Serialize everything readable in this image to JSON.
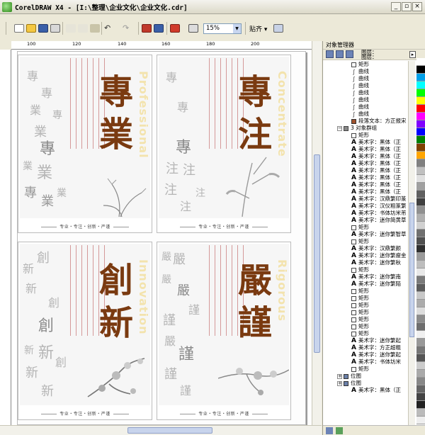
{
  "window": {
    "title": "CorelDRAW X4 - [I:\\整理\\企业文化\\企业文化.cdr]",
    "minimize": "_",
    "restore": "▫",
    "close": "×"
  },
  "toolbar": {
    "zoom_value": "15%",
    "snap_label": "贴齐 ▾",
    "icons": [
      "new-icon",
      "open-icon",
      "save-icon",
      "print-icon",
      "cut-icon",
      "copy-icon",
      "paste-icon",
      "undo-icon",
      "redo-icon",
      "import-icon",
      "export-icon",
      "app-launcher-icon",
      "welcome-icon",
      "zoom-dropdown",
      "snap-icon",
      "options-icon"
    ]
  },
  "ruler": {
    "ticks": [
      "100",
      "120",
      "140",
      "160",
      "180",
      "200"
    ]
  },
  "cards": [
    {
      "big_chars": [
        "專",
        "業"
      ],
      "english": "Professional",
      "footer": "专业・专注・创新・严谨",
      "gray_chars": [
        "專",
        "專",
        "業",
        "專",
        "業",
        "專",
        "業",
        "業",
        "專",
        "業",
        "業"
      ]
    },
    {
      "big_chars": [
        "專",
        "注"
      ],
      "english": "Concentrate",
      "footer": "专业・专注・创新・严谨",
      "gray_chars": [
        "專",
        "專",
        "專",
        "注",
        "注",
        "注",
        "注",
        "注"
      ]
    },
    {
      "big_chars": [
        "創",
        "新"
      ],
      "english": "Innovation",
      "footer": "专业・专注・创新・严谨",
      "gray_chars": [
        "新",
        "創",
        "新",
        "創",
        "創",
        "新",
        "新",
        "創",
        "新",
        "新"
      ]
    },
    {
      "big_chars": [
        "嚴",
        "謹"
      ],
      "english": "Rigorous",
      "footer": "专业・专注・创新・严谨",
      "gray_chars": [
        "嚴",
        "嚴",
        "嚴",
        "嚴",
        "謹",
        "謹",
        "嚴",
        "謹",
        "謹",
        "謹"
      ]
    }
  ],
  "docker": {
    "title": "对象管理器",
    "layer_line1": "图层：",
    "layer_line2": "图层：",
    "tree": [
      {
        "type": "rect",
        "label": "矩形"
      },
      {
        "type": "curve",
        "label": "曲线"
      },
      {
        "type": "curve",
        "label": "曲线"
      },
      {
        "type": "curve",
        "label": "曲线"
      },
      {
        "type": "curve",
        "label": "曲线"
      },
      {
        "type": "curve",
        "label": "曲线"
      },
      {
        "type": "curve",
        "label": "曲线"
      },
      {
        "type": "curve",
        "label": "曲线"
      },
      {
        "type": "ptext",
        "label": "段落文本：方正报宋"
      },
      {
        "type": "group",
        "label": "3 对象群组",
        "expander": "−"
      },
      {
        "type": "rect",
        "label": "矩形"
      },
      {
        "type": "text",
        "label": "美术字：黑体（正"
      },
      {
        "type": "text",
        "label": "美术字：黑体（正"
      },
      {
        "type": "text",
        "label": "美术字：黑体（正"
      },
      {
        "type": "text",
        "label": "美术字：黑体（正"
      },
      {
        "type": "text",
        "label": "美术字：黑体（正"
      },
      {
        "type": "text",
        "label": "美术字：黑体（正"
      },
      {
        "type": "text",
        "label": "美术字：黑体（正"
      },
      {
        "type": "text",
        "label": "美术字：黑体（正"
      },
      {
        "type": "text",
        "label": "美术字：汉鼎繁印篆"
      },
      {
        "type": "text",
        "label": "美术字：汉仪粗篆繁"
      },
      {
        "type": "text",
        "label": "美术字：书体坊米芾"
      },
      {
        "type": "text",
        "label": "美术字：迷你简黄草"
      },
      {
        "type": "rect",
        "label": "矩形"
      },
      {
        "type": "text",
        "label": "美术字：迷你繁智草"
      },
      {
        "type": "rect",
        "label": "矩形"
      },
      {
        "type": "text",
        "label": "美术字：汉鼎繁颜"
      },
      {
        "type": "text",
        "label": "美术字：迷你繁瘦金"
      },
      {
        "type": "text",
        "label": "美术字：迷你繁秋"
      },
      {
        "type": "rect",
        "label": "矩形"
      },
      {
        "type": "text",
        "label": "美术字：迷你繁南"
      },
      {
        "type": "text",
        "label": "美术字：迷你繁陌"
      },
      {
        "type": "rect",
        "label": "矩形"
      },
      {
        "type": "rect",
        "label": "矩形"
      },
      {
        "type": "rect",
        "label": "矩形"
      },
      {
        "type": "rect",
        "label": "矩形"
      },
      {
        "type": "rect",
        "label": "矩形"
      },
      {
        "type": "rect",
        "label": "矩形"
      },
      {
        "type": "rect",
        "label": "矩形"
      },
      {
        "type": "text",
        "label": "美术字：迷你繁起"
      },
      {
        "type": "text",
        "label": "美术字：方正超粗"
      },
      {
        "type": "text",
        "label": "美术字：迷你繁起"
      },
      {
        "type": "text",
        "label": "美术字：书体坊米"
      },
      {
        "type": "rect",
        "label": "矩形"
      },
      {
        "type": "bitmap",
        "label": "位图",
        "expander": "+"
      },
      {
        "type": "bitmap",
        "label": "位图",
        "expander": "+"
      },
      {
        "type": "text",
        "label": "美术字：黑体（正"
      }
    ]
  },
  "palette_colors": [
    "#ffffff",
    "#000000",
    "#00a0e9",
    "#00ffff",
    "#00ff00",
    "#ffff00",
    "#ff0000",
    "#ff00ff",
    "#8000ff",
    "#0000ff",
    "#008000",
    "#804000",
    "#ffa500",
    "#808080",
    "#c0c0c0",
    "#e0e0e0",
    "#a0a0a0",
    "#606060",
    "#404040",
    "#909090",
    "#b0b0b0",
    "#d0d0d0",
    "#707070",
    "#505050",
    "#303030",
    "#9a9a9a",
    "#bdbdbd",
    "#e8e8e8",
    "#7a7a7a",
    "#5c5c5c",
    "#c8c8c8",
    "#acacac",
    "#dddddd",
    "#8c8c8c",
    "#6e6e6e",
    "#f0f0f0",
    "#999999",
    "#777777",
    "#555555",
    "#cccccc",
    "#aaaaaa",
    "#888888",
    "#666666",
    "#444444",
    "#222222",
    "#bbbbbb",
    "#eeeeee"
  ]
}
